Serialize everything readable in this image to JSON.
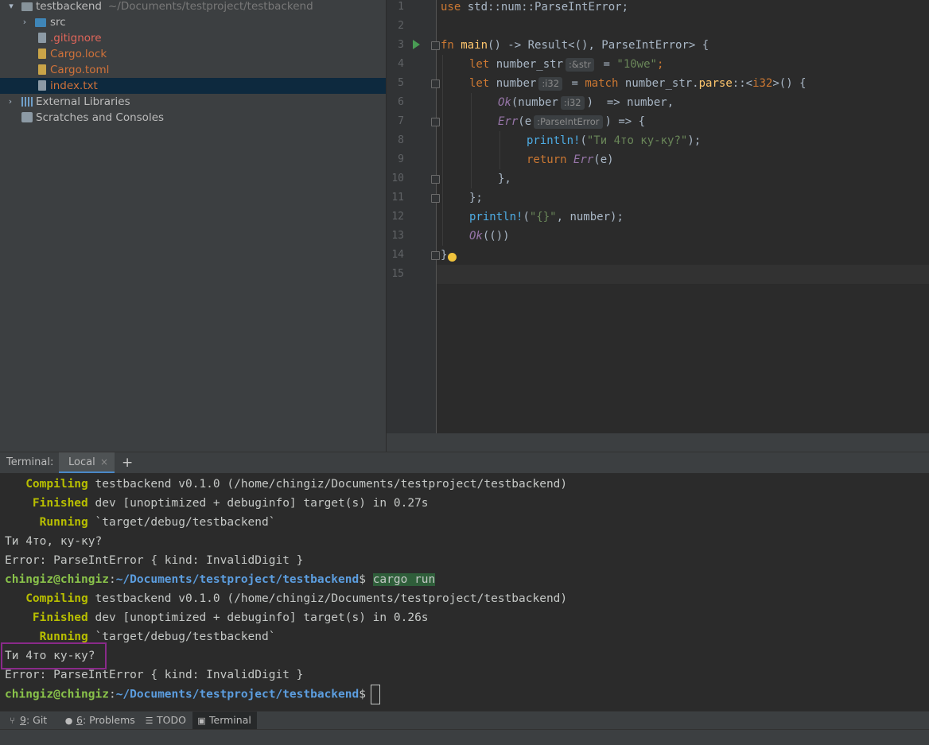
{
  "project": {
    "root": {
      "name": "testbackend",
      "path": "~/Documents/testproject/testbackend"
    },
    "items": [
      {
        "label": "src"
      },
      {
        "label": ".gitignore"
      },
      {
        "label": "Cargo.lock"
      },
      {
        "label": "Cargo.toml"
      },
      {
        "label": "index.txt"
      },
      {
        "label": "External Libraries"
      },
      {
        "label": "Scratches and Consoles"
      }
    ]
  },
  "editor": {
    "line_numbers": [
      "1",
      "2",
      "3",
      "4",
      "5",
      "6",
      "7",
      "8",
      "9",
      "10",
      "11",
      "12",
      "13",
      "14",
      "15"
    ],
    "code": {
      "l1_use": "use",
      "l1_rest": " std::num::ParseIntError;",
      "l3_fn": "fn",
      "l3_name": " main",
      "l3_rest": "() -> Result<(), ParseIntError> {",
      "l4_let": "let",
      "l4_var": " number_str",
      "l4_hint": ":&str",
      "l4_eq": " = ",
      "l4_str": "\"10we\"",
      "l4_end": ";",
      "l5_let": "let",
      "l5_var": " number",
      "l5_hint": ":i32",
      "l5_eq": " = ",
      "l5_match": "match",
      "l5_mid": " number_str.",
      "l5_parse": "parse",
      "l5_turbo": "::<",
      "l5_type": "i32",
      "l5_end": ">() {",
      "l6_ok": "Ok",
      "l6_open": "(number",
      "l6_hint": ":i32",
      "l6_end": ")  => number,",
      "l7_err": "Err",
      "l7_open": "(e",
      "l7_hint": ":ParseIntError",
      "l7_end": ") => {",
      "l8_mac": "println!",
      "l8_open": "(",
      "l8_str": "\"Ти 4то ку-ку?\"",
      "l8_end": ");",
      "l9_ret": "return",
      "l9_err": " Err",
      "l9_end": "(e)",
      "l10": "},",
      "l11": "};",
      "l12_mac": "println!",
      "l12_open": "(",
      "l12_str": "\"{}\"",
      "l12_end": ", number);",
      "l13_ok": "Ok",
      "l13_end": "(())",
      "l14": "}"
    }
  },
  "terminal": {
    "label": "Terminal:",
    "tab": "Local",
    "tab_close": "×",
    "add": "+",
    "lines": {
      "compiling": "Compiling",
      "compiling_rest": " testbackend v0.1.0 (/home/chingiz/Documents/testproject/testbackend)",
      "finished": "Finished",
      "finished_rest_1": " dev [unoptimized + debuginfo] target(s) in 0.27s",
      "finished_rest_2": " dev [unoptimized + debuginfo] target(s) in 0.26s",
      "running": "Running",
      "running_rest": " `target/debug/testbackend`",
      "output_1": "Ти 4то, ку-ку?",
      "error": "Error: ParseIntError { kind: InvalidDigit }",
      "output_2": "Ти 4то ку-ку?",
      "prompt_user": "chingiz@chingiz",
      "prompt_sep": ":",
      "prompt_path": "~/Documents/testproject/testbackend",
      "prompt_dollar": "$ ",
      "command": "cargo run"
    }
  },
  "toolbar": {
    "git": {
      "key": "9",
      "label": ": Git"
    },
    "problems": {
      "key": "6",
      "label": ": Problems"
    },
    "todo": "TODO",
    "terminal": "Terminal"
  },
  "icons": [
    "chevron-down-icon",
    "chevron-right-icon",
    "folder-icon",
    "file-icon",
    "libraries-icon",
    "scratch-icon",
    "run-icon",
    "lightbulb-icon",
    "plus-icon",
    "close-icon",
    "git-icon",
    "problems-icon",
    "list-icon",
    "terminal-icon"
  ],
  "colors": {
    "keyword": "#cc7832",
    "function": "#ffc66d",
    "string": "#6a8759",
    "macro": "#4eade5",
    "prompt_user": "#89c24a",
    "prompt_path": "#5c9ee0",
    "cargo_status": "#b8bf00",
    "highlight_box": "#8a2a8a"
  }
}
